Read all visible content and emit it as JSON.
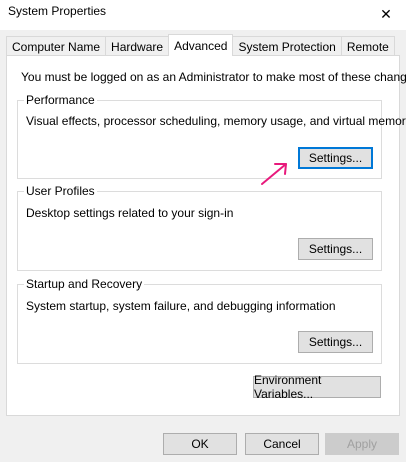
{
  "window": {
    "title": "System Properties",
    "close_glyph": "✕"
  },
  "tabs": [
    {
      "label": "Computer Name"
    },
    {
      "label": "Hardware"
    },
    {
      "label": "Advanced",
      "active": true
    },
    {
      "label": "System Protection"
    },
    {
      "label": "Remote"
    }
  ],
  "advanced": {
    "admin_note": "You must be logged on as an Administrator to make most of these changes.",
    "performance": {
      "title": "Performance",
      "description": "Visual effects, processor scheduling, memory usage, and virtual memory",
      "button": "Settings..."
    },
    "user_profiles": {
      "title": "User Profiles",
      "description": "Desktop settings related to your sign-in",
      "button": "Settings..."
    },
    "startup_recovery": {
      "title": "Startup and Recovery",
      "description": "System startup, system failure, and debugging information",
      "button": "Settings..."
    },
    "env_button": "Environment Variables..."
  },
  "footer": {
    "ok": "OK",
    "cancel": "Cancel",
    "apply": "Apply"
  },
  "colors": {
    "focus_border": "#0078d7",
    "annotation_arrow": "#e8197c"
  },
  "annotation": {
    "icon": "pink-arrow-icon"
  }
}
